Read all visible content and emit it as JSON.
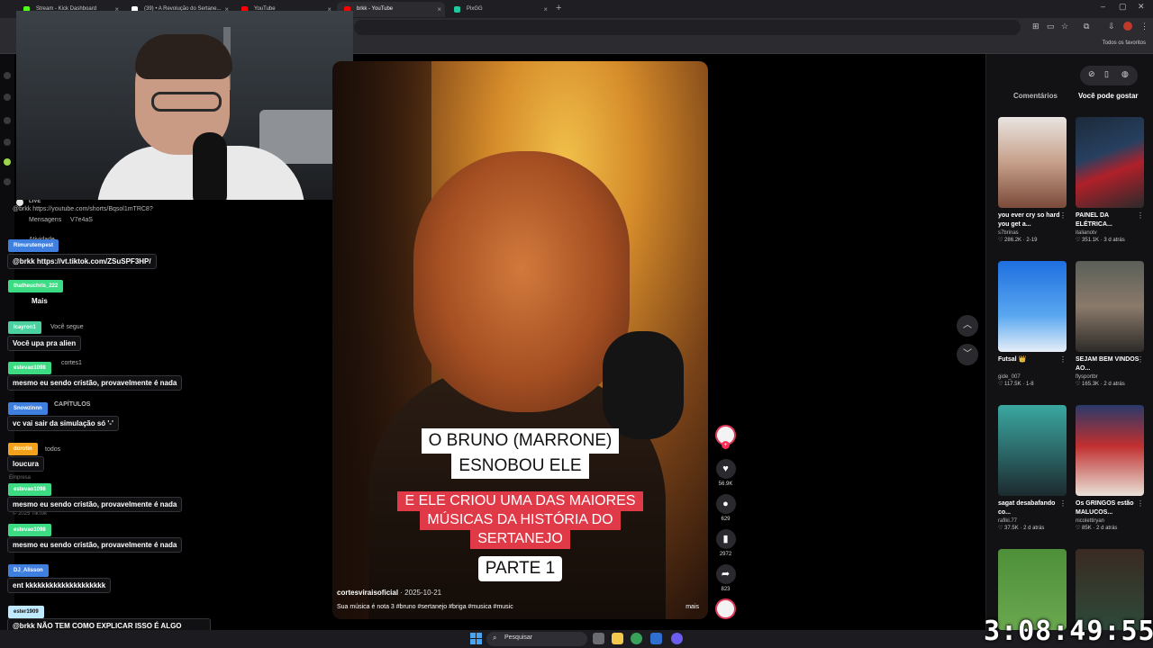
{
  "browser": {
    "tabs": [
      {
        "label": "Stream - Kick Dashboard",
        "color": "#53fc18"
      },
      {
        "label": "(39) • A Revolução do Sertane...",
        "color": "#ffffff"
      },
      {
        "label": "YouTube",
        "color": "#ff0000"
      },
      {
        "label": "brkk - YouTube",
        "color": "#ff0000"
      },
      {
        "label": "PixGG",
        "color": "#1ec8a0"
      }
    ],
    "bookmarks_all": "Todos os favoritos"
  },
  "chat": {
    "live_label": "LIVE",
    "messages": [
      {
        "user": "Rimurutempest",
        "user_color": "#3f7fe0",
        "text": "@brkk https://vt.tiktok.com/ZSuSPF3HP/"
      },
      {
        "user": "thatheuchris_222",
        "user_color": "#3ddc84",
        "text": "Mais"
      },
      {
        "user": "lcayron1",
        "user_color": "#4bd1a0",
        "text": "Você upa pra alien"
      },
      {
        "user": "estevao1098",
        "user_color": "#3ddc84",
        "text": "mesmo eu sendo cristão, provavelmente é nada"
      },
      {
        "user": "Snowzinnn",
        "user_color": "#3f7fe0",
        "text": "vc vai sair da simulação só '-'"
      },
      {
        "user": "dorotin",
        "user_color": "#f4a21c",
        "text": "loucura"
      },
      {
        "user": "estevao1098",
        "user_color": "#3ddc84",
        "text": "mesmo eu sendo cristão, provavelmente é nada"
      },
      {
        "user": "estevao1098",
        "user_color": "#3ddc84",
        "text": "mesmo eu sendo cristão, provavelmente é nada"
      },
      {
        "user": "DJ_Alisson",
        "user_color": "#3f7fe0",
        "text": "ent kkkkkkkkkkkkkkkkkkkk"
      },
      {
        "user": "ester1909",
        "user_color": "#bfe9ff",
        "text": "@brkk NÃO TEM COMO EXPLICAR ISSO É ALGO MUITO N SEI EXPLICAR"
      }
    ],
    "ghost": {
      "link": "@brkk https://youtube.com/shorts/Bqsol1mTRC8?",
      "mensagens": "Mensagens",
      "atividade": "Atividade",
      "mais": "Mais",
      "voce_segue": "Você segue",
      "cortes": "cortes1",
      "capitulos": "CAPÍTULOS",
      "todos": "todos",
      "empresa": "Empresa",
      "copyright": "© 2025 TikTok",
      "code": "V7e4aS"
    }
  },
  "video": {
    "caption_line1": "O BRUNO (MARRONE)",
    "caption_line2": "ESNOBOU ELE",
    "red_line1": "E ELE CRIOU UMA DAS MAIORES",
    "red_line2": "MÚSICAS DA HISTÓRIA DO",
    "red_line3": "SERTANEJO",
    "part": "PARTE 1",
    "author": "cortesviraisoficial",
    "date": "· 2025-10-21",
    "description": "Sua música é nota 3 #bruno #sertanejo #briga #musica #music",
    "more": "mais"
  },
  "actions": {
    "likes": "56.9K",
    "comments": "629",
    "saves": "2972",
    "shares": "823"
  },
  "side": {
    "tab_comments": "Comentários",
    "tab_recommended": "Você pode gostar",
    "cards": [
      {
        "title": "you ever cry so hard you get a...",
        "author": "s7brinas",
        "likes": "286.2K",
        "ago": "2-19"
      },
      {
        "title": "PAINEL DA ELÉTRICA...",
        "author": "italianotv",
        "likes": "351.1K",
        "ago": "3 d atrás"
      },
      {
        "title": "Futsal 👑",
        "author": "gide_007",
        "likes": "117.5K",
        "ago": "1-8"
      },
      {
        "title": "SEJAM BEM VINDOS AO...",
        "author": "flysportbr",
        "likes": "165.3K",
        "ago": "2 d atrás"
      },
      {
        "title": "sagat desabafando co...",
        "author": "rafiki.77",
        "likes": "37.5K",
        "ago": "2 d atrás"
      },
      {
        "title": "Os GRINGOS estão MALUCOS...",
        "author": "nicolettiryan",
        "likes": "85K",
        "ago": "2 d atrás"
      }
    ]
  },
  "taskbar": {
    "search": "Pesquisar"
  },
  "timer": "3:08:49:55"
}
